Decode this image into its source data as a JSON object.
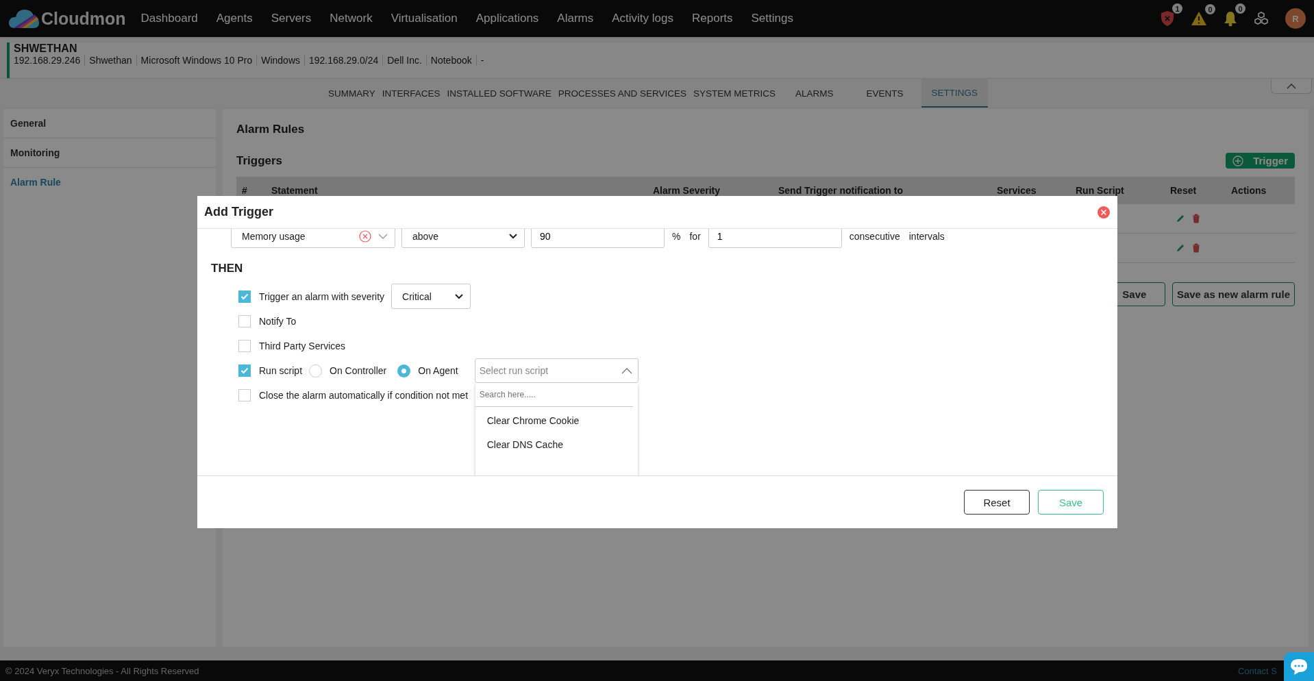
{
  "nav": {
    "logo": "Cloudmon",
    "items": [
      "Dashboard",
      "Agents",
      "Servers",
      "Network",
      "Virtualisation",
      "Applications",
      "Alarms",
      "Activity logs",
      "Reports",
      "Settings"
    ],
    "indicators": [
      {
        "kind": "critical",
        "count": "1"
      },
      {
        "kind": "warning",
        "count": "0"
      },
      {
        "kind": "notice",
        "count": "0"
      }
    ],
    "avatar": "R"
  },
  "host": {
    "name": "SHWETHAN",
    "details": [
      "192.168.29.246",
      "Shwethan",
      "Microsoft Windows 10 Pro",
      "Windows",
      "192.168.29.0/24",
      "Dell Inc.",
      "Notebook",
      "-"
    ]
  },
  "tabs": [
    {
      "label": "SUMMARY",
      "selected": false
    },
    {
      "label": "INTERFACES",
      "selected": false
    },
    {
      "label": "INSTALLED SOFTWARE",
      "selected": false
    },
    {
      "label": "PROCESSES AND SERVICES",
      "selected": false
    },
    {
      "label": "SYSTEM METRICS",
      "selected": false
    },
    {
      "label": "ALARMS",
      "selected": false
    },
    {
      "label": "EVENTS",
      "selected": false
    },
    {
      "label": "SETTINGS",
      "selected": true
    }
  ],
  "sidebar": {
    "items": [
      {
        "label": "General",
        "selected": false
      },
      {
        "label": "Monitoring",
        "selected": false
      },
      {
        "label": "Alarm Rule",
        "selected": true
      }
    ]
  },
  "content": {
    "title": "Alarm Rules",
    "section": "Triggers",
    "add_button": "Trigger",
    "table": {
      "columns": [
        "#",
        "Statement",
        "Alarm Severity",
        "Send Trigger notification to",
        "Services",
        "Run Script",
        "Reset",
        "Actions"
      ],
      "rows": [
        {
          "kind": "rule"
        },
        {
          "kind": "rule"
        }
      ]
    },
    "buttons": [
      "Save",
      "Save as new alarm rule"
    ]
  },
  "modal": {
    "title": "Add Trigger",
    "condition": {
      "metric": "Memory usage",
      "operator": "above",
      "value": "90",
      "unit": "%",
      "for": "for",
      "count": "1",
      "words": [
        "consecutive",
        "intervals"
      ]
    },
    "then_label": "THEN",
    "actions": [
      {
        "kind": "severity",
        "label": "Trigger an alarm with severity",
        "checked": true,
        "severity": "Critical"
      },
      {
        "kind": "plain",
        "label": "Notify To",
        "checked": false
      },
      {
        "kind": "plain",
        "label": "Third Party Services",
        "checked": false
      },
      {
        "kind": "script",
        "label": "Run script",
        "checked": true,
        "radios": [
          {
            "label": "On Controller",
            "selected": false
          },
          {
            "label": "On Agent",
            "selected": true
          }
        ],
        "script_select": {
          "placeholder": "Select run script",
          "expanded": true,
          "search_placeholder": "Search here.....",
          "options": [
            "Clear Chrome Cookie",
            "Clear DNS Cache"
          ]
        }
      },
      {
        "kind": "plain",
        "label": "Close the alarm automatically if condition not met",
        "checked": false
      }
    ],
    "buttons": [
      "Reset",
      "Save"
    ]
  },
  "footer": {
    "copyright": "© 2024 Veryx Technologies - All Rights Reserved",
    "contact": "Contact S"
  }
}
